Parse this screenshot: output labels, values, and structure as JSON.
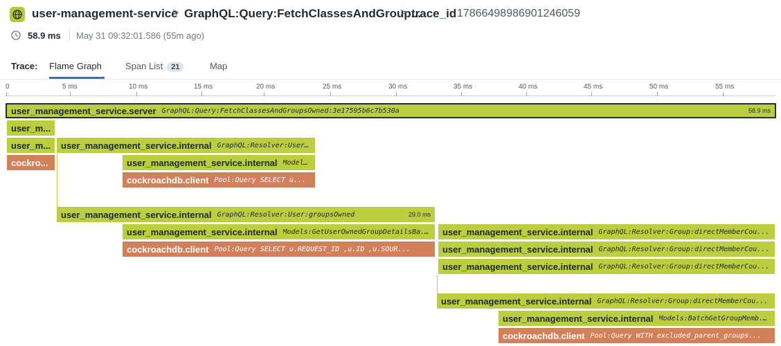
{
  "header": {
    "service_icon": "globe-icon",
    "service_name": "user-management-service",
    "separator": ">",
    "resource_name": "GraphQL:Query:FetchClassesAndGroup...",
    "trace_label": "trace_id",
    "trace_id": "1786649898690124605​9"
  },
  "meta": {
    "clock_icon": "clock-icon",
    "duration": "58.9 ms",
    "timestamp": "May 31 09:32:01.586 (55m ago)"
  },
  "tabs": {
    "label": "Trace:",
    "items": [
      {
        "label": "Flame Graph",
        "active": true
      },
      {
        "label": "Span List",
        "badge": "21"
      },
      {
        "label": "Map"
      }
    ]
  },
  "ruler": {
    "ticks": [
      "0",
      "5 ms",
      "10 ms",
      "15 ms",
      "20 ms",
      "25 ms",
      "30 ms",
      "35 ms",
      "40 ms",
      "45 ms",
      "50 ms",
      "55 ms"
    ]
  },
  "colors": {
    "green": "#bccd3f",
    "orange": "#d2805a",
    "accent": "#3b6ec6"
  },
  "spans": [
    {
      "name": "user_management_service.server",
      "resource": "GraphQL:Query:FetchClassesAndGroupsOwned:3e17595b6c7b530a",
      "duration": "58.9 ms",
      "color": "green",
      "selected": true
    },
    {
      "name": "user_m...",
      "resource": "",
      "duration": "",
      "color": "green"
    },
    {
      "name": "user_m...",
      "resource": "",
      "duration": "",
      "color": "green"
    },
    {
      "name": "user_management_service.internal",
      "resource": "GraphQL:Resolver:User...",
      "duration": "",
      "color": "green"
    },
    {
      "name": "cockro...",
      "resource": "",
      "duration": "",
      "color": "orange"
    },
    {
      "name": "user_management_service.internal",
      "resource": "Models...",
      "duration": "",
      "color": "green"
    },
    {
      "name": "cockroachdb.client",
      "resource": "Pool:Query  SELECT  u...",
      "duration": "",
      "color": "orange"
    },
    {
      "name": "user_management_service.internal",
      "resource": "GraphQL:Resolver:User:groupsOwned",
      "duration": "29.0 ms",
      "color": "green"
    },
    {
      "name": "user_management_service.internal",
      "resource": "Models:GetUserOwnedGroupDetailsBa...",
      "duration": "",
      "color": "green"
    },
    {
      "name": "cockroachdb.client",
      "resource": "Pool:Query  SELECT  u.REQUEST_ID  ,u.ID  ,u.SOUR...",
      "duration": "",
      "color": "orange"
    },
    {
      "name": "user_management_service.internal",
      "resource": "GraphQL:Resolver:Group:directMemberCou...",
      "duration": "",
      "color": "green"
    },
    {
      "name": "user_management_service.internal",
      "resource": "GraphQL:Resolver:Group:directMemberCou...",
      "duration": "",
      "color": "green"
    },
    {
      "name": "user_management_service.internal",
      "resource": "GraphQL:Resolver:Group:directMemberCou...",
      "duration": "",
      "color": "green"
    },
    {
      "name": "user_management_service.internal",
      "resource": "GraphQL:Resolver:Group:directMemberCou...",
      "duration": "",
      "color": "green"
    },
    {
      "name": "user_management_service.internal",
      "resource": "Models:BatchGetGroupMemb...",
      "duration": "",
      "color": "green"
    },
    {
      "name": "cockroachdb.client",
      "resource": "Pool:Query  WITH excluded_parent_groups...",
      "duration": "",
      "color": "orange"
    }
  ]
}
